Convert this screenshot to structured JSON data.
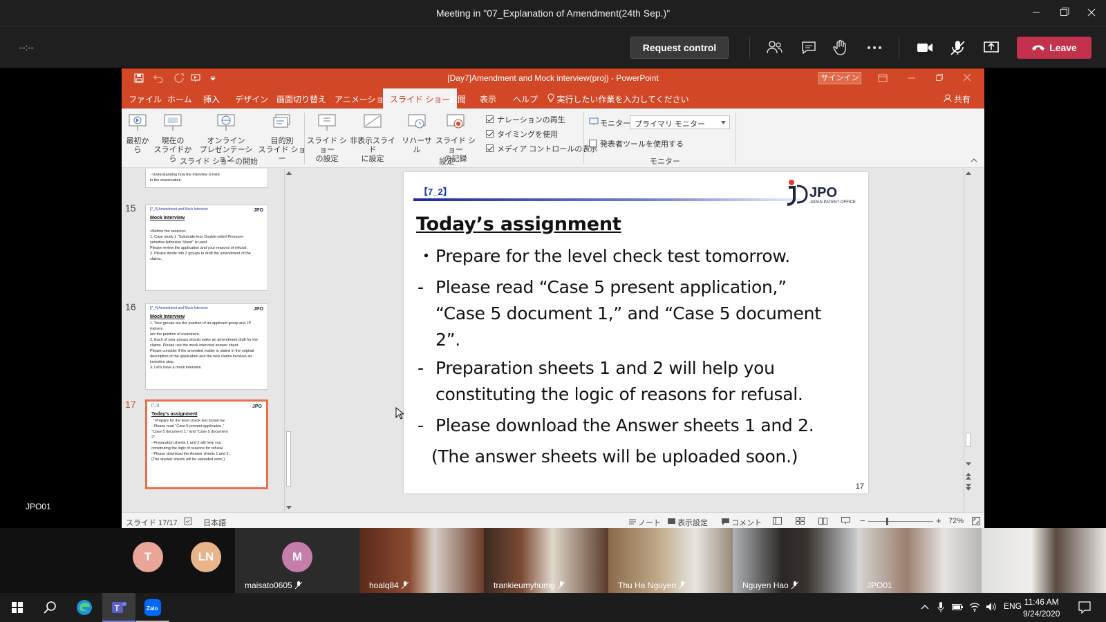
{
  "teams": {
    "window_title": "Meeting in \"07_Explanation of Amendment(24th Sep.)\"",
    "timer": "--:--",
    "request_control": "Request control",
    "leave": "Leave",
    "presenter_label": "JPO01",
    "accent_leave": "#c4314b"
  },
  "powerpoint": {
    "doc_title": "[Day7]Amendment and Mock interview(proj)  -  PowerPoint",
    "signin": "サインイン",
    "share": "共有",
    "menu": [
      "ファイル",
      "ホーム",
      "挿入",
      "デザイン",
      "画面切り替え",
      "アニメーション",
      "スライド ショー",
      "校閲",
      "表示",
      "ヘルプ"
    ],
    "active_tab": "スライド ショー",
    "tell_me": "実行したい作業を入力してください",
    "ribbon": {
      "from_beginning": "最初から",
      "from_current_1": "現在の",
      "from_current_2": "スライドから",
      "online_1": "オンライン",
      "online_2": "プレゼンテーション",
      "custom_1": "目的別",
      "custom_2": "スライド ショー",
      "group_start": "スライド ショーの開始",
      "setup_1": "スライド ショー",
      "setup_2": "の設定",
      "hide_1": "非表示スライド",
      "hide_2": "に設定",
      "rehearse": "リハーサル",
      "record_1": "スライド ショー",
      "record_2": "の記録",
      "chk_narration": "ナレーションの再生",
      "chk_timing": "タイミングを使用",
      "chk_media": "メディア コントロールの表示",
      "group_setup": "設定",
      "monitor_label": "モニター:",
      "monitor_value": "プライマリ モニター",
      "chk_presenter": "発表者ツールを使用する",
      "group_monitor": "モニター"
    },
    "thumbnails": {
      "prev_tail_1": "- Understanding how the interview is held",
      "prev_tail_2": "in the examination.",
      "items": [
        {
          "num": "15",
          "hdr": "[7_3]   Amendment and Mock Interview",
          "title": "Mock Interview",
          "lines": [
            "<Before the session>",
            "1.  Case study 1 \"Substrate-less Double-sided Pressure-",
            "    sensitive Adhesive Sheet\" is used.",
            "    Please review the application and your reasons of refusal.",
            "",
            "2.  Please divide into 2 groups to draft the amendment of the",
            "    claims."
          ]
        },
        {
          "num": "16",
          "hdr": "[7_4]   Amendment and Mock Interview",
          "title": "Mock Interview",
          "lines": [
            "1.  Your groups are the position of  an applicant group and JP trainers",
            "    are the position of  examiners.",
            "2.  Each of your groups should make an amendment draft for the",
            "    claims. Please use the mock interview answer sheet.",
            "    Please consider if the amended matter is stated in the original",
            "    description of the application and the new claims involves an",
            "    inventive step.",
            "3.  Let's have a mock interview."
          ]
        },
        {
          "num": "17",
          "hdr": "[7_2]",
          "title": "Today's assignment",
          "lines": [
            "・Prepare for the level check test tomorrow.",
            "-  Please read \"Case 5 present application,\"",
            "   \"Case 5 document 1,\" and \"Case 5 document",
            "   2\".",
            "-  Preparation sheets 1 and 2 will help you",
            "   constituting the logic of reasons for refusal.",
            "-  Please download the Answer sheets 1 and 2.",
            "   (The answer sheets will be uploaded soon.)"
          ]
        }
      ]
    },
    "slide": {
      "tag": "【7_2】",
      "logo_text": "JPO",
      "logo_sub": "JAPAN PATENT OFFICE",
      "heading": "Today’s assignment",
      "b1_mark": "・",
      "b1": "Prepare for the level check test tomorrow.",
      "b2_mark": "-",
      "b2_l1": "Please read “Case 5 present application,”",
      "b2_l2": "“Case 5 document 1,” and “Case 5 document",
      "b2_l3": "2”.",
      "b3_mark": "-",
      "b3_l1": "Preparation sheets 1 and 2 will help you",
      "b3_l2": "constituting the logic of reasons for refusal.",
      "b4_mark": "-",
      "b4": "Please download the Answer sheets 1 and 2.",
      "b5": "(The answer sheets will be uploaded soon.)",
      "page_number": "17"
    },
    "status": {
      "slide_count": "スライド 17/17",
      "language": "日本語",
      "notes": "ノート",
      "display_settings": "表示設定",
      "comments": "コメント",
      "zoom": "72%"
    }
  },
  "participants": [
    {
      "initials": "T",
      "color": "#e8a598"
    },
    {
      "initials": "LN",
      "color": "#e8b48c"
    },
    {
      "initials": "M",
      "color": "#c77daa",
      "name": "maisato0605"
    },
    {
      "name": "hoalq84"
    },
    {
      "name": "trankieumyhumg"
    },
    {
      "name": "Thu Ha Nguyen"
    },
    {
      "name": "Nguyen Hao"
    },
    {
      "name": "JPO01"
    }
  ],
  "taskbar": {
    "language": "ENG",
    "time": "11:46 AM",
    "date": "9/24/2020",
    "zalo": "Zalo"
  }
}
